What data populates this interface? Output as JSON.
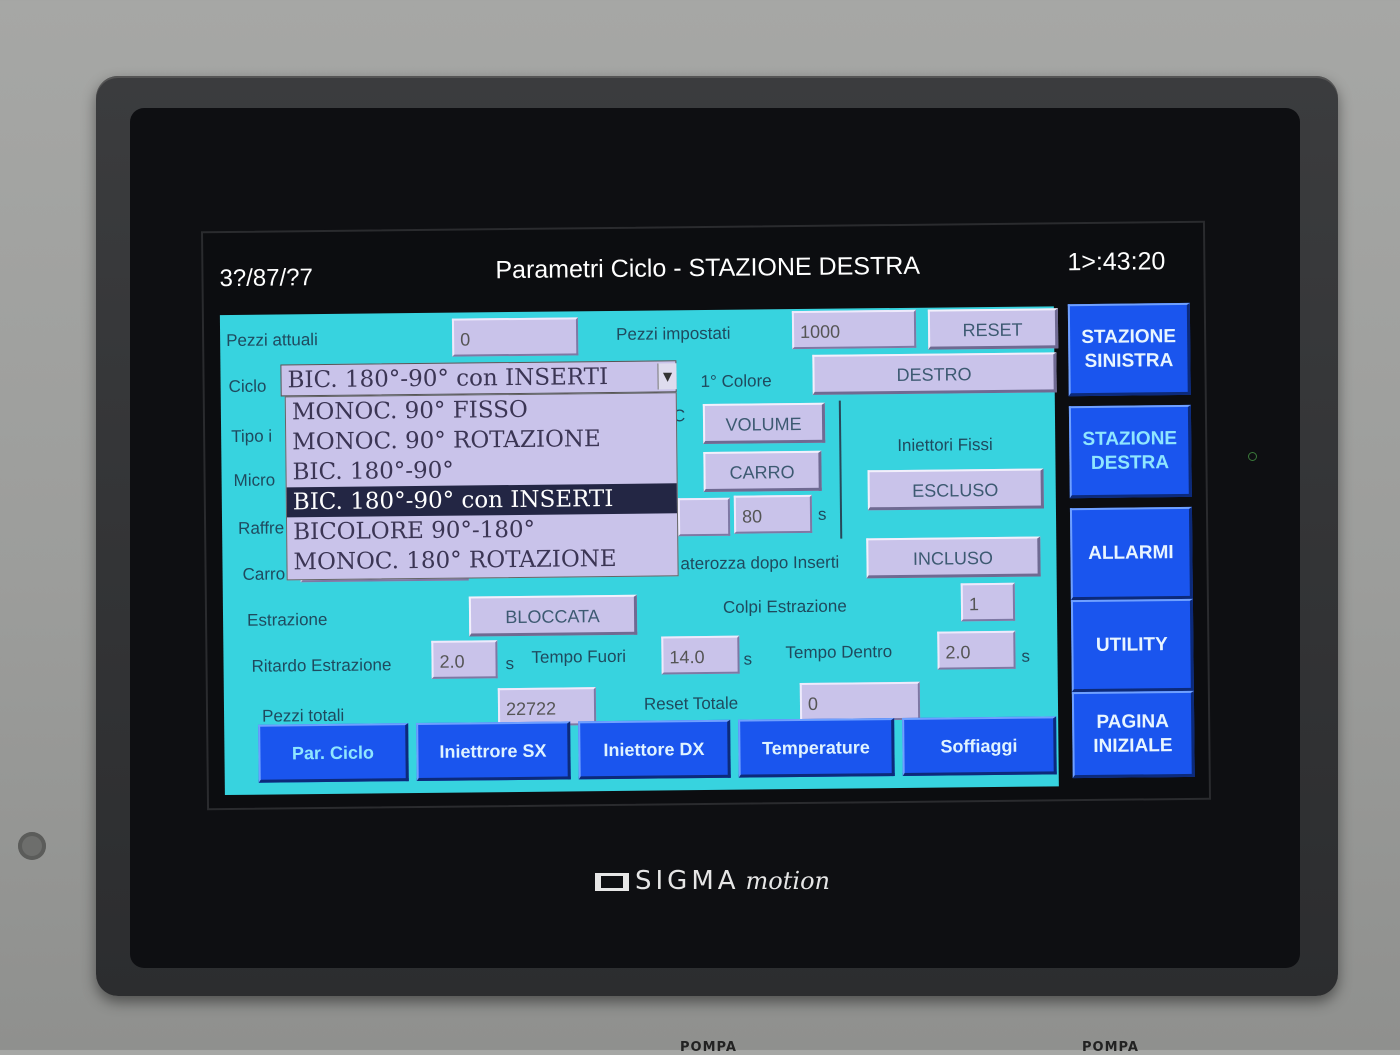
{
  "header": {
    "date": "3?/87/?7",
    "title": "Parametri Ciclo - STAZIONE DESTRA",
    "time": "1>:43:20"
  },
  "form": {
    "pezzi_attuali": {
      "label": "Pezzi attuali",
      "value": "0"
    },
    "pezzi_impostati": {
      "label": "Pezzi impostati",
      "value": "1000"
    },
    "reset_button": "RESET",
    "ciclo": {
      "label": "Ciclo",
      "selected": "BIC. 180°-90° con INSERTI",
      "options": [
        "MONOC. 90° FISSO",
        "MONOC. 90° ROTAZIONE",
        "BIC. 180°-90°",
        "BIC. 180°-90° con INSERTI",
        "BICOLORE 90°-180°",
        "MONOC. 180° ROTAZIONE"
      ],
      "selected_index": 3
    },
    "primo_colore": {
      "label": "1° Colore",
      "value": "DESTRO"
    },
    "tipo_label": "Tipo i",
    "volume_button": "VOLUME",
    "c_fragment": "C",
    "micro_label": "Micro",
    "carro_button": "CARRO",
    "iniettori_fissi": {
      "label": "Iniettori Fissi",
      "value": "ESCLUSO"
    },
    "raffreddamento": {
      "label": "Raffre",
      "value": "80",
      "unit": "s"
    },
    "carro_label": "Carro",
    "materozza": {
      "label": "aterozza dopo Inserti",
      "value": "INCLUSO"
    },
    "estrazione": {
      "label": "Estrazione",
      "value": "BLOCCATA"
    },
    "colpi_estrazione": {
      "label": "Colpi Estrazione",
      "value": "1"
    },
    "ritardo_estrazione": {
      "label": "Ritardo Estrazione",
      "value": "2.0",
      "unit": "s"
    },
    "tempo_fuori": {
      "label": "Tempo Fuori",
      "value": "14.0",
      "unit": "s"
    },
    "tempo_dentro": {
      "label": "Tempo Dentro",
      "value": "2.0",
      "unit": "s"
    },
    "pezzi_totali": {
      "label": "Pezzi totali",
      "value": "22722"
    },
    "reset_totale": {
      "label": "Reset Totale",
      "value": "0"
    }
  },
  "bottom_nav": [
    "Par. Ciclo",
    "Iniettrore SX",
    "Iniettore DX",
    "Temperature",
    "Soffiaggi"
  ],
  "side_nav": [
    "STAZIONE\nSINISTRA",
    "STAZIONE\nDESTRA",
    "ALLARMI",
    "UTILITY",
    "PAGINA\nINIZIALE"
  ],
  "device": {
    "brand": "SIGMA",
    "brand_script": "motion",
    "label_left": "POMPA",
    "label_right": "POMPA"
  }
}
